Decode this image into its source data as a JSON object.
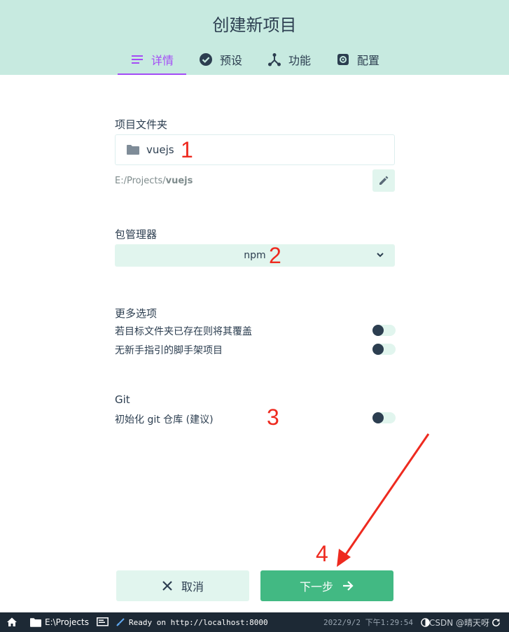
{
  "title": "创建新项目",
  "tabs": [
    {
      "label": "详情",
      "icon": "list-icon",
      "active": true
    },
    {
      "label": "预设",
      "icon": "check-circle-icon",
      "active": false
    },
    {
      "label": "功能",
      "icon": "branch-icon",
      "active": false
    },
    {
      "label": "配置",
      "icon": "settings-icon",
      "active": false
    }
  ],
  "folder": {
    "label": "项目文件夹",
    "value": "vuejs",
    "path_prefix": "E:/Projects/",
    "path_name": "vuejs"
  },
  "package_manager": {
    "label": "包管理器",
    "value": "npm"
  },
  "more_options": {
    "label": "更多选项",
    "items": [
      {
        "label": "若目标文件夹已存在则将其覆盖",
        "enabled": false
      },
      {
        "label": "无新手指引的脚手架项目",
        "enabled": false
      }
    ]
  },
  "git": {
    "label": "Git",
    "init_label": "初始化 git 仓库 (建议)",
    "enabled": false
  },
  "annotations": [
    "1",
    "2",
    "3",
    "4"
  ],
  "buttons": {
    "cancel": "取消",
    "next": "下一步"
  },
  "statusbar": {
    "folder": "E:\\Projects",
    "message": "Ready on http://localhost:8000",
    "datetime": "2022/9/2 下午1:29:54",
    "watermark": "CSDN @晴天呀"
  },
  "colors": {
    "accent": "#a44cf6",
    "primary": "#42b983",
    "header_bg": "#c7eae0",
    "annotation": "#ee2a1f"
  }
}
